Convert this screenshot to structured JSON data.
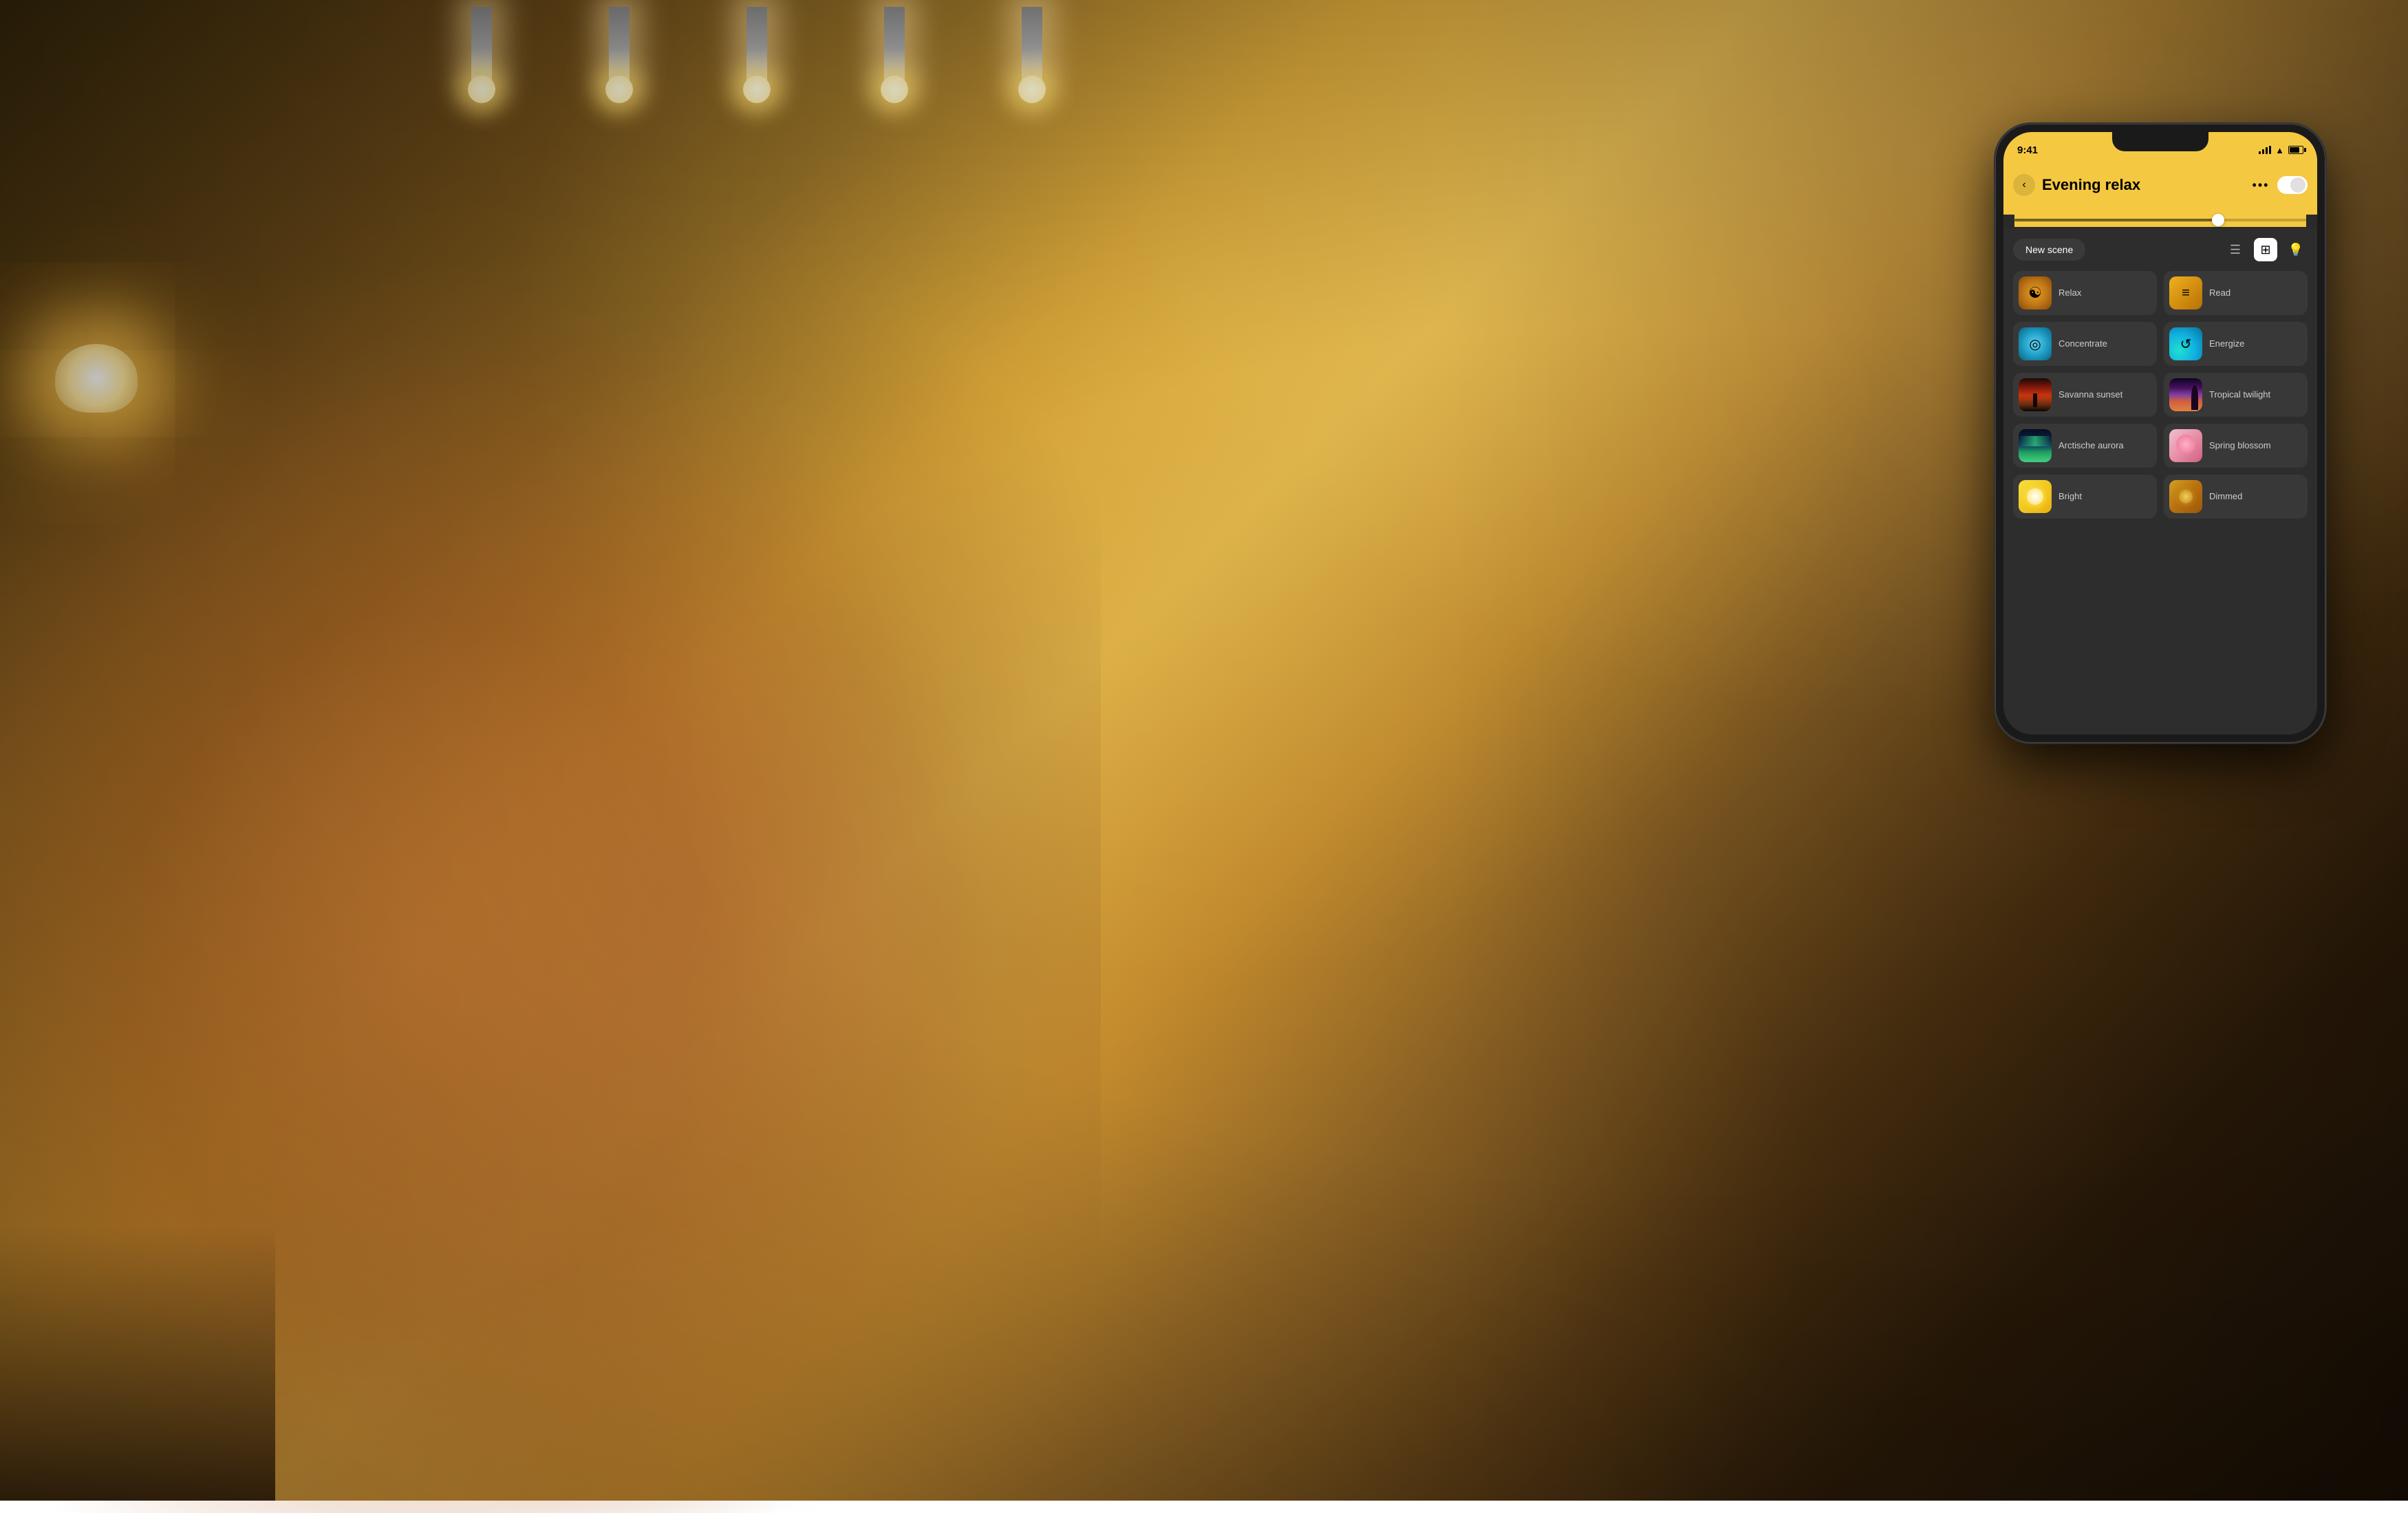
{
  "status_bar": {
    "time": "9:41",
    "signal_label": "signal",
    "wifi_label": "wifi",
    "battery_label": "battery"
  },
  "header": {
    "title": "Evening relax",
    "back_label": "‹",
    "more_label": "•••"
  },
  "toolbar": {
    "new_scene_label": "New scene",
    "view_list_label": "☰",
    "view_gallery_label": "⊞",
    "view_light_label": "💡"
  },
  "scenes": [
    {
      "id": "relax",
      "name": "Relax",
      "icon_type": "relax"
    },
    {
      "id": "read",
      "name": "Read",
      "icon_type": "read"
    },
    {
      "id": "concentrate",
      "name": "Concentrate",
      "icon_type": "concentrate"
    },
    {
      "id": "energize",
      "name": "Energize",
      "icon_type": "energize"
    },
    {
      "id": "savanna",
      "name": "Savanna sunset",
      "icon_type": "savanna"
    },
    {
      "id": "tropical",
      "name": "Tropical twilight",
      "icon_type": "tropical"
    },
    {
      "id": "arctic",
      "name": "Arctische aurora",
      "icon_type": "arctic"
    },
    {
      "id": "spring",
      "name": "Spring blossom",
      "icon_type": "spring"
    },
    {
      "id": "bright",
      "name": "Bright",
      "icon_type": "bright"
    },
    {
      "id": "dimmed",
      "name": "Dimmed",
      "icon_type": "dimmed"
    }
  ],
  "colors": {
    "header_bg": "#f5c842",
    "content_bg": "#2d2d2d",
    "phone_bg": "#1a1a1a",
    "scene_tile_bg": "#383838"
  }
}
